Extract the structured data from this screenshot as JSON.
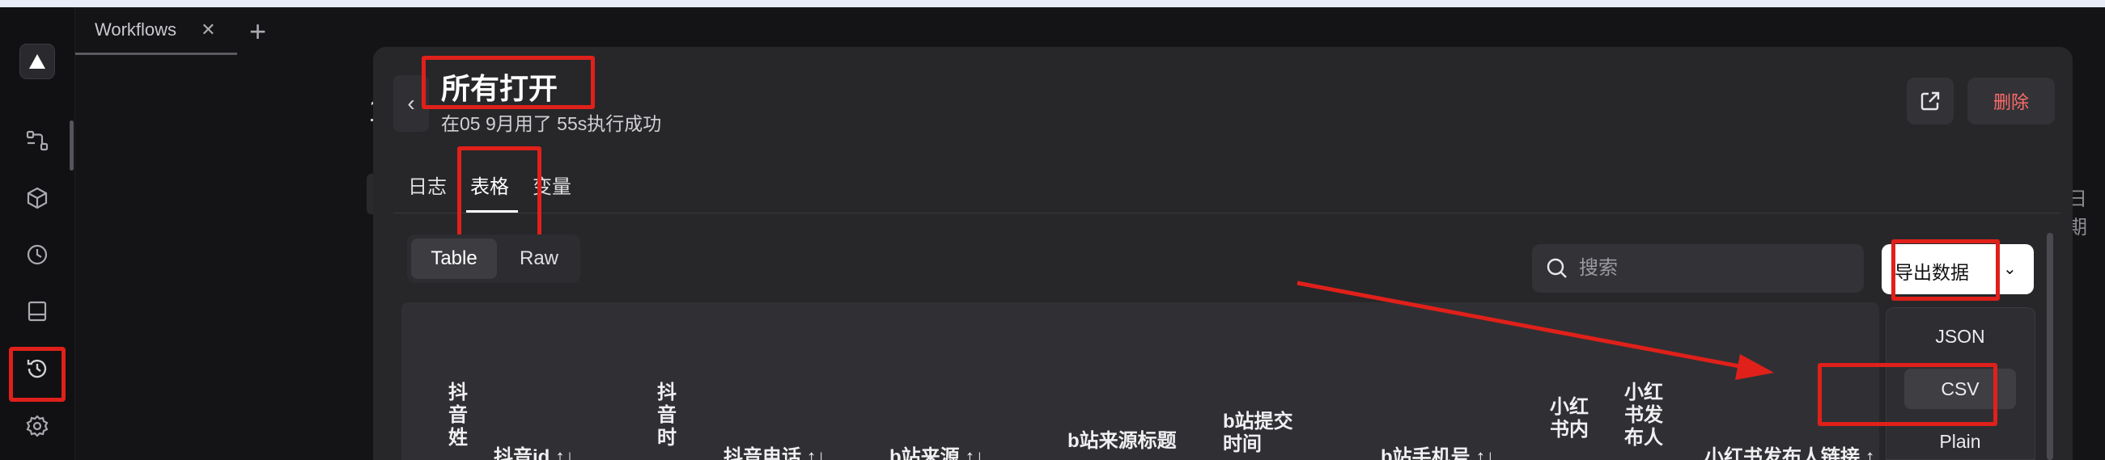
{
  "app": {
    "tabs": [
      {
        "label": "Workflows"
      }
    ],
    "add_tab": "+",
    "close_tab": "✕"
  },
  "rail": {
    "items": [
      {
        "icon": "workflow-icon"
      },
      {
        "icon": "package-icon"
      },
      {
        "icon": "clock-icon"
      },
      {
        "icon": "panel-icon"
      },
      {
        "icon": "history-icon",
        "active": true
      },
      {
        "icon": "gear-icon"
      }
    ]
  },
  "background": {
    "partial_digit": "1",
    "partial_date_label": "日期"
  },
  "modal": {
    "title": "所有打开",
    "subtitle": "在05 9月用了 55s执行成功",
    "back": "‹",
    "delete_label": "删除",
    "tabs": [
      {
        "label": "日志"
      },
      {
        "label": "表格",
        "active": true
      },
      {
        "label": "变量"
      }
    ],
    "view_toggle": [
      {
        "label": "Table",
        "active": true
      },
      {
        "label": "Raw"
      }
    ],
    "search": {
      "placeholder": "搜索"
    },
    "export": {
      "label": "导出数据",
      "menu": [
        {
          "label": "JSON"
        },
        {
          "label": "CSV",
          "hovered": true
        },
        {
          "label": "Plain"
        }
      ]
    },
    "table": {
      "columns": [
        {
          "label": "抖音姓",
          "vertical": true
        },
        {
          "label": "抖音id ↑↓"
        },
        {
          "label": "抖音时",
          "vertical": true
        },
        {
          "label": "抖音电话 ↑↓"
        },
        {
          "label": "b站来源 ↑↓"
        },
        {
          "label": "b站来源标题"
        },
        {
          "label": "b站提交时间"
        },
        {
          "label": "b站手机号 ↑↓"
        },
        {
          "label": "小红书内"
        },
        {
          "label": "小红书发布人"
        },
        {
          "label": "小红书发布人链接 ↑"
        }
      ]
    }
  },
  "colors": {
    "annotation": "#e0201a",
    "modal_bg": "#27272a",
    "danger_text": "#ff6b6b"
  }
}
